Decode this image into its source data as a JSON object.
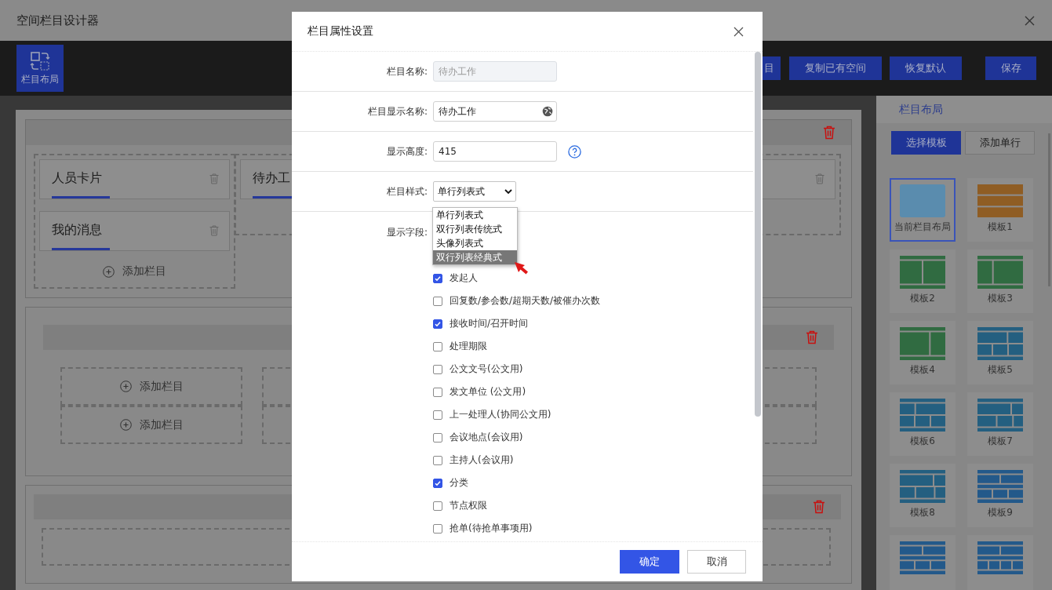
{
  "window": {
    "title": "空间栏目设计器"
  },
  "toolbar": {
    "layout_button": "栏目布局",
    "buttons": [
      {
        "label": "目",
        "kind": "partial"
      },
      {
        "label": "复制已有空间",
        "kind": "normal"
      },
      {
        "label": "恢复默认",
        "kind": "normal"
      },
      {
        "label": "保存",
        "kind": "save"
      }
    ]
  },
  "canvas": {
    "sections": [
      {
        "kind": "cards",
        "left_cards": [
          "人员卡片",
          "我的消息"
        ],
        "add_label": "添加栏目",
        "right_cards": [
          "待办工"
        ]
      },
      {
        "kind": "slots",
        "left_slots": [
          "添加栏目",
          "添加栏目"
        ]
      },
      {
        "kind": "empty"
      }
    ]
  },
  "right_panel": {
    "title": "栏目布局",
    "tabs": [
      {
        "label": "选择模板",
        "selected": true
      },
      {
        "label": "添加单行",
        "selected": false
      }
    ],
    "templates": [
      {
        "label": "当前栏目布局",
        "kind": "current",
        "selected": true,
        "color": "#5a8cae"
      },
      {
        "label": "模板1",
        "kind": "stack3",
        "selected": false,
        "color": "#8f5d24"
      },
      {
        "label": "模板2",
        "kind": "split-half",
        "selected": false,
        "color": "#306b41"
      },
      {
        "label": "模板3",
        "kind": "split-left",
        "selected": false,
        "color": "#306b41"
      },
      {
        "label": "模板4",
        "kind": "split-right",
        "selected": false,
        "color": "#306b41"
      },
      {
        "label": "模板5",
        "kind": "grid-a",
        "selected": false,
        "color": "#245f80"
      },
      {
        "label": "模板6",
        "kind": "grid-b",
        "selected": false,
        "color": "#245f80"
      },
      {
        "label": "模板7",
        "kind": "grid-c",
        "selected": false,
        "color": "#245f80"
      },
      {
        "label": "模板8",
        "kind": "grid-d",
        "selected": false,
        "color": "#245f80"
      },
      {
        "label": "模板9",
        "kind": "grid-e",
        "selected": false,
        "color": "#23598a"
      },
      {
        "kind": "grid-e",
        "selected": false,
        "color": "#23598a"
      },
      {
        "kind": "grid-f",
        "selected": false,
        "color": "#23598a"
      }
    ]
  },
  "dialog": {
    "title": "栏目属性设置",
    "fields": [
      {
        "label": "栏目名称:",
        "kind": "input",
        "value": "待办工作",
        "disabled": true
      },
      {
        "label": "栏目显示名称:",
        "kind": "input-globe",
        "value": "待办工作",
        "disabled": false
      },
      {
        "label": "显示高度:",
        "kind": "input-help",
        "value": "415",
        "disabled": false
      },
      {
        "label": "栏目样式:",
        "kind": "select",
        "value": "单行列表式",
        "options": [
          {
            "label": "单行列表式",
            "highlighted": false
          },
          {
            "label": "双行列表传统式",
            "highlighted": false
          },
          {
            "label": "头像列表式",
            "highlighted": false
          },
          {
            "label": "双行列表经典式",
            "highlighted": true
          }
        ]
      },
      {
        "label": "显示字段:",
        "kind": "checklist",
        "items": [
          {
            "label": "发起人",
            "checked": true
          },
          {
            "label": "回复数/参会数/超期天数/被催办次数",
            "checked": false
          },
          {
            "label": "接收时间/召开时间",
            "checked": true
          },
          {
            "label": "处理期限",
            "checked": false
          },
          {
            "label": "公文文号(公文用)",
            "checked": false
          },
          {
            "label": "发文单位 (公文用)",
            "checked": false
          },
          {
            "label": "上一处理人(协同公文用)",
            "checked": false
          },
          {
            "label": "会议地点(会议用)",
            "checked": false
          },
          {
            "label": "主持人(会议用)",
            "checked": false
          },
          {
            "label": "分类",
            "checked": true
          },
          {
            "label": "节点权限",
            "checked": false
          },
          {
            "label": "抢单(待抢单事项用)",
            "checked": false
          }
        ]
      }
    ],
    "buttons": [
      {
        "label": "确定",
        "kind": "primary"
      },
      {
        "label": "取消",
        "kind": "default"
      }
    ]
  }
}
